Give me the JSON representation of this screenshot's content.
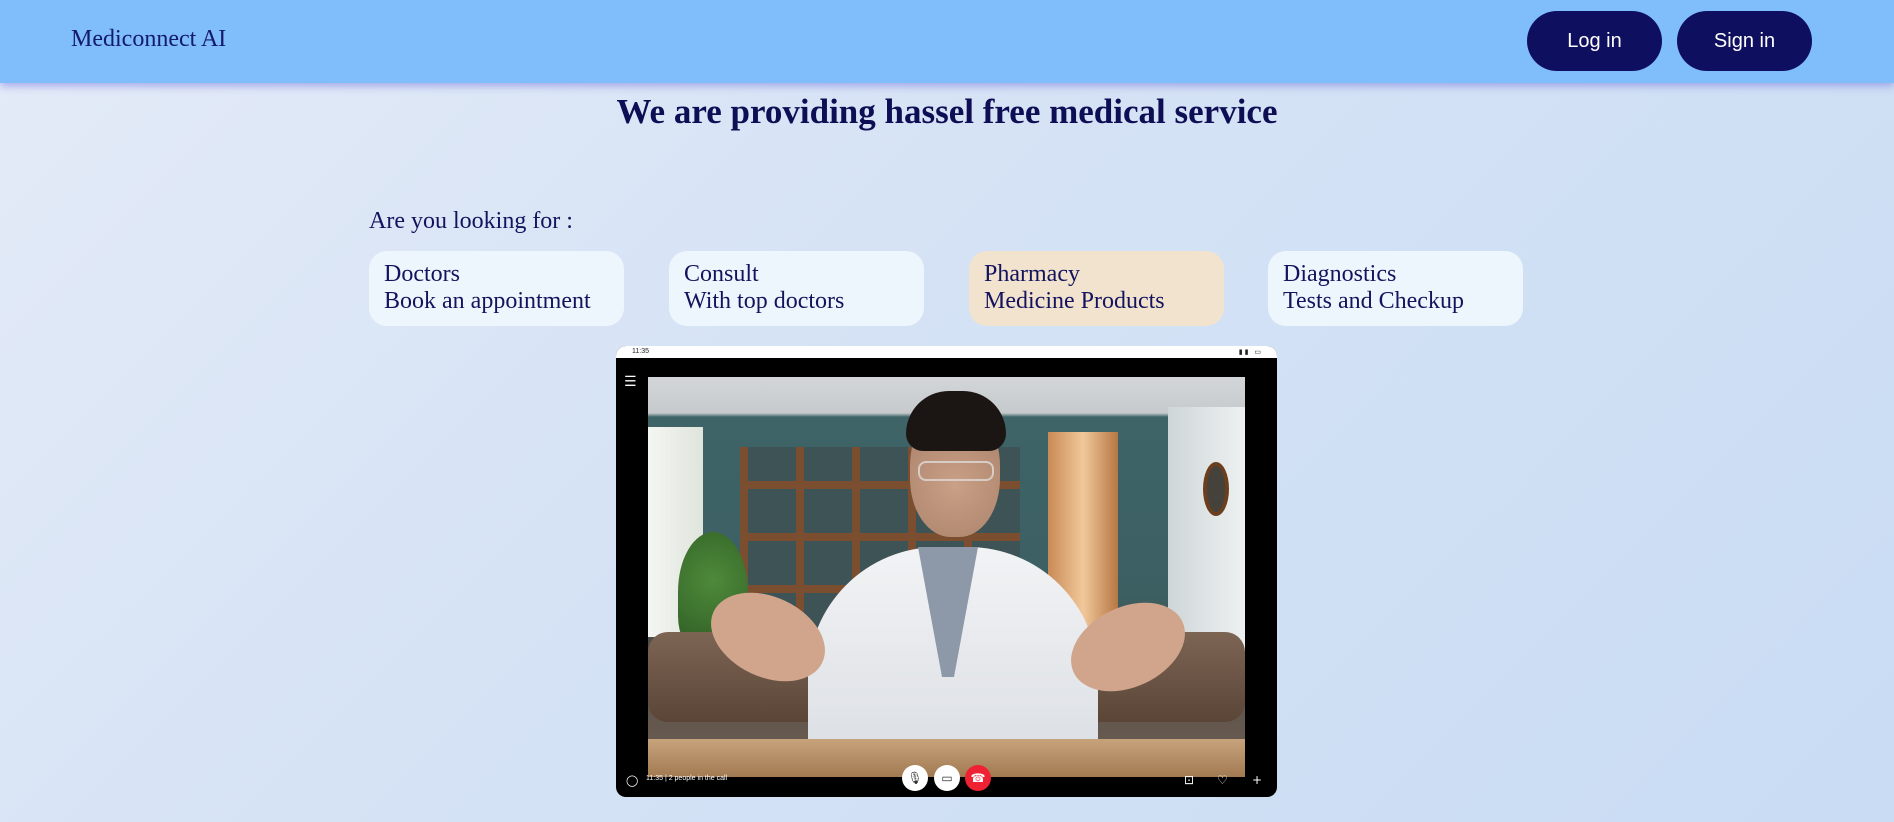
{
  "header": {
    "brand": "Mediconnect AI",
    "login_label": "Log in",
    "signin_label": "Sign in"
  },
  "main": {
    "headline": "We are providing hassel free medical service",
    "prompt": "Are you looking for :",
    "cards": [
      {
        "title": "Doctors",
        "subtitle": "Book an appointment"
      },
      {
        "title": "Consult",
        "subtitle": "With top doctors"
      },
      {
        "title": "Pharmacy",
        "subtitle": "Medicine Products"
      },
      {
        "title": "Diagnostics",
        "subtitle": "Tests and Checkup"
      }
    ]
  },
  "video_call": {
    "status_time": "11:35",
    "call_info": "11:35 | 2 people in the call"
  },
  "colors": {
    "header_bg": "#7fbdfb",
    "button_bg": "#0f0f5f",
    "card_bg": "#eef6fd",
    "highlight_card_bg": "#f2e3cf",
    "hangup": "#ee2233"
  }
}
